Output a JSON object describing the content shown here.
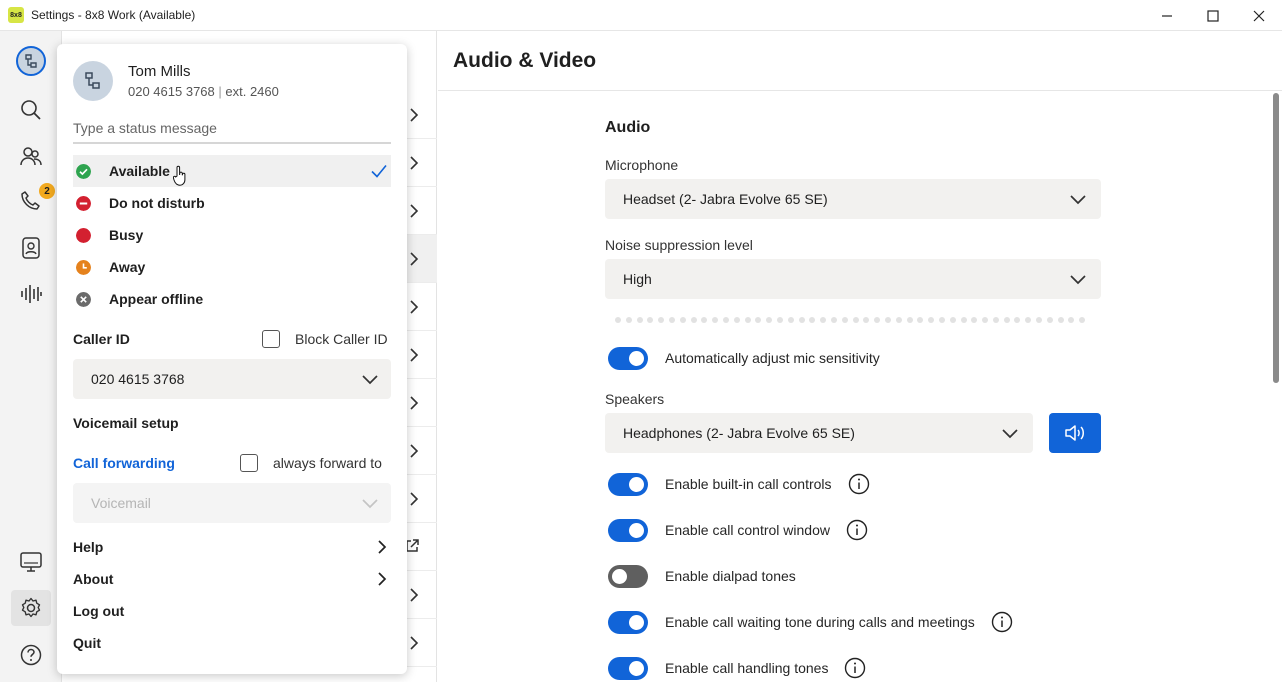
{
  "window": {
    "logo_text": "8x8",
    "title": "Settings - 8x8 Work (Available)"
  },
  "rail": {
    "badge_count": "2",
    "items": [
      "status-avatar",
      "search-icon",
      "contacts-icon",
      "phone-icon",
      "contact-card-icon",
      "voice-waveform-icon",
      "desktop-icon",
      "settings-icon",
      "help-icon"
    ]
  },
  "main": {
    "title": "Audio & Video",
    "section_title": "Audio",
    "microphone_label": "Microphone",
    "microphone_value": "Headset (2- Jabra Evolve 65 SE)",
    "noise_label": "Noise suppression level",
    "noise_value": "High",
    "auto_adjust_label": "Automatically adjust mic sensitivity",
    "speakers_label": "Speakers",
    "speakers_value": "Headphones (2- Jabra Evolve 65 SE)",
    "toggles": [
      {
        "label": "Enable built-in call controls",
        "on": true
      },
      {
        "label": "Enable call control window",
        "on": true
      },
      {
        "label": "Enable dialpad tones",
        "on": false
      },
      {
        "label": "Enable call waiting tone during calls and meetings",
        "on": true
      },
      {
        "label": "Enable call handling tones",
        "on": true
      }
    ]
  },
  "popup": {
    "user_name": "Tom Mills",
    "user_phone": "020 4615 3768",
    "user_ext": "ext. 2460",
    "status_placeholder": "Type a status message",
    "statuses": [
      {
        "label": "Available",
        "color": "#2ea44f",
        "selected": true
      },
      {
        "label": "Do not disturb",
        "color": "#d32030"
      },
      {
        "label": "Busy",
        "color": "#d32030"
      },
      {
        "label": "Away",
        "color": "#e5821d"
      },
      {
        "label": "Appear offline",
        "color": "#6b6b6b"
      }
    ],
    "caller_id_label": "Caller ID",
    "block_caller_id_label": "Block Caller ID",
    "caller_id_value": "020 4615 3768",
    "voicemail_setup_label": "Voicemail setup",
    "call_forwarding_label": "Call forwarding",
    "always_forward_label": "always forward to",
    "forward_value": "Voicemail",
    "help_label": "Help",
    "about_label": "About",
    "logout_label": "Log out",
    "quit_label": "Quit"
  },
  "colors": {
    "accent": "#1164d8",
    "available": "#2ea44f",
    "badge": "#f2a91f"
  }
}
